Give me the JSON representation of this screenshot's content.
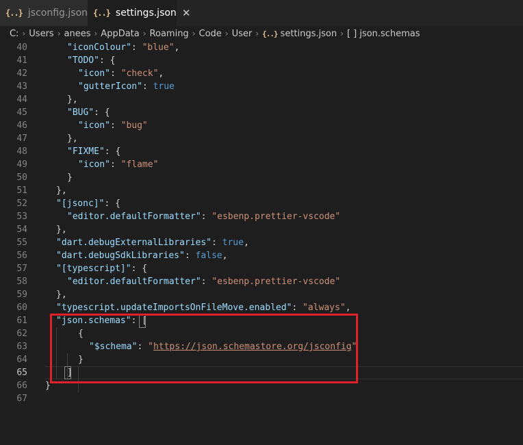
{
  "tabs": [
    {
      "icon": "{..}",
      "label": "jsconfig.json"
    },
    {
      "icon": "{..}",
      "label": "settings.json",
      "close": "✕"
    }
  ],
  "breadcrumb": {
    "items": [
      "C:",
      "Users",
      "anees",
      "AppData",
      "Roaming",
      "Code",
      "User"
    ],
    "file_icon": "{..}",
    "file": "settings.json",
    "symbol_icon": "[ ]",
    "symbol": "json.schemas"
  },
  "editor": {
    "lines": [
      {
        "n": "40",
        "t": [
          [
            "k",
            "\"iconColour\""
          ],
          [
            "p",
            ": "
          ],
          [
            "s",
            "\"blue\""
          ],
          [
            "p",
            ","
          ]
        ]
      },
      {
        "n": "41",
        "t": [
          [
            "k",
            "\"TODO\""
          ],
          [
            "p",
            ": {"
          ]
        ]
      },
      {
        "n": "42",
        "t": [
          [
            "k",
            "\"icon\""
          ],
          [
            "p",
            ": "
          ],
          [
            "s",
            "\"check\""
          ],
          [
            "p",
            ","
          ]
        ]
      },
      {
        "n": "43",
        "t": [
          [
            "k",
            "\"gutterIcon\""
          ],
          [
            "p",
            ": "
          ],
          [
            "b",
            "true"
          ]
        ]
      },
      {
        "n": "44",
        "t": [
          [
            "p",
            "},"
          ]
        ]
      },
      {
        "n": "45",
        "t": [
          [
            "k",
            "\"BUG\""
          ],
          [
            "p",
            ": {"
          ]
        ]
      },
      {
        "n": "46",
        "t": [
          [
            "k",
            "\"icon\""
          ],
          [
            "p",
            ": "
          ],
          [
            "s",
            "\"bug\""
          ]
        ]
      },
      {
        "n": "47",
        "t": [
          [
            "p",
            "},"
          ]
        ]
      },
      {
        "n": "48",
        "t": [
          [
            "k",
            "\"FIXME\""
          ],
          [
            "p",
            ": {"
          ]
        ]
      },
      {
        "n": "49",
        "t": [
          [
            "k",
            "\"icon\""
          ],
          [
            "p",
            ": "
          ],
          [
            "s",
            "\"flame\""
          ]
        ]
      },
      {
        "n": "50",
        "t": [
          [
            "p",
            "}"
          ]
        ]
      },
      {
        "n": "51",
        "t": [
          [
            "p",
            "},"
          ]
        ]
      },
      {
        "n": "52",
        "t": [
          [
            "k",
            "\"[jsonc]\""
          ],
          [
            "p",
            ": {"
          ]
        ]
      },
      {
        "n": "53",
        "t": [
          [
            "k",
            "\"editor.defaultFormatter\""
          ],
          [
            "p",
            ": "
          ],
          [
            "s",
            "\"esbenp.prettier-vscode\""
          ]
        ]
      },
      {
        "n": "54",
        "t": [
          [
            "p",
            "},"
          ]
        ]
      },
      {
        "n": "55",
        "t": [
          [
            "k",
            "\"dart.debugExternalLibraries\""
          ],
          [
            "p",
            ": "
          ],
          [
            "b",
            "true"
          ],
          [
            "p",
            ","
          ]
        ]
      },
      {
        "n": "56",
        "t": [
          [
            "k",
            "\"dart.debugSdkLibraries\""
          ],
          [
            "p",
            ": "
          ],
          [
            "b",
            "false"
          ],
          [
            "p",
            ","
          ]
        ]
      },
      {
        "n": "57",
        "t": [
          [
            "k",
            "\"[typescript]\""
          ],
          [
            "p",
            ": {"
          ]
        ]
      },
      {
        "n": "58",
        "t": [
          [
            "k",
            "\"editor.defaultFormatter\""
          ],
          [
            "p",
            ": "
          ],
          [
            "s",
            "\"esbenp.prettier-vscode\""
          ]
        ]
      },
      {
        "n": "59",
        "t": [
          [
            "p",
            "},"
          ]
        ]
      },
      {
        "n": "60",
        "t": [
          [
            "k",
            "\"typescript.updateImportsOnFileMove.enabled\""
          ],
          [
            "p",
            ": "
          ],
          [
            "s",
            "\"always\""
          ],
          [
            "p",
            ","
          ]
        ]
      },
      {
        "n": "61",
        "t": [
          [
            "k",
            "\"json.schemas\""
          ],
          [
            "p",
            ": ["
          ]
        ]
      },
      {
        "n": "62",
        "t": [
          [
            "p",
            "{"
          ]
        ]
      },
      {
        "n": "63",
        "t": [
          [
            "k",
            "\"$schema\""
          ],
          [
            "p",
            ": "
          ],
          [
            "s",
            "\""
          ],
          [
            "u",
            "https://json.schemastore.org/jsconfig"
          ],
          [
            "s",
            "\""
          ]
        ]
      },
      {
        "n": "64",
        "t": [
          [
            "p",
            "}"
          ]
        ]
      },
      {
        "n": "65",
        "t": [
          [
            "p",
            "]"
          ]
        ]
      },
      {
        "n": "66",
        "t": [
          [
            "p",
            "}"
          ]
        ]
      },
      {
        "n": "67",
        "t": []
      }
    ]
  },
  "colors": {
    "highlight_border": "#e0202a",
    "background": "#1e1e1e"
  }
}
